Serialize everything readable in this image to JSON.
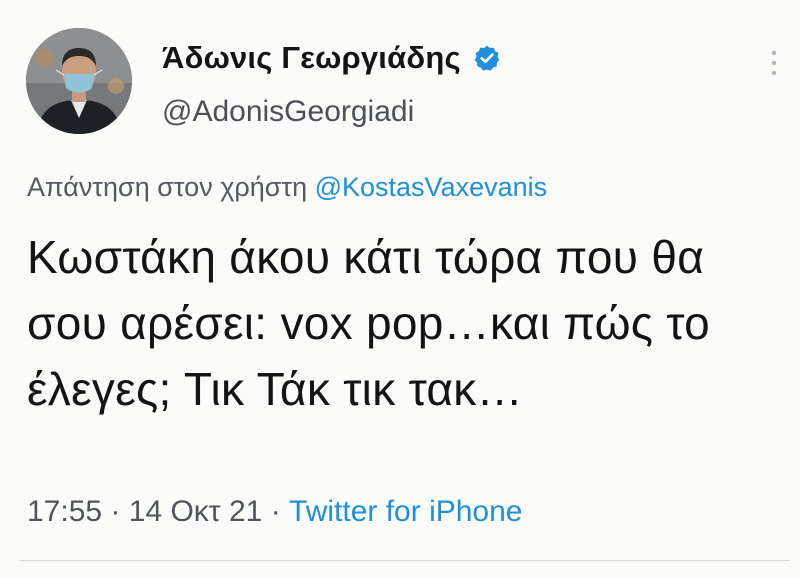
{
  "author": {
    "display_name": "Άδωνις Γεωργιάδης",
    "handle": "@AdonisGeorgiadi",
    "verified": true,
    "avatar_icon": "profile-photo"
  },
  "reply": {
    "prefix": "Απάντηση στον χρήστη",
    "mention": "@KostasVaxevanis"
  },
  "tweet": {
    "text": "Κωστάκη άκου κάτι τώρα που θα σου αρέσει: vox pop…και πώς το έλεγες; Τικ Τάκ τικ τακ…"
  },
  "meta": {
    "time": "17:55",
    "separator": "·",
    "date": "14 Οκτ 21",
    "source": "Twitter for iPhone"
  },
  "colors": {
    "accent": "#1f90db",
    "text": "#141414",
    "secondary": "#50555b",
    "background": "#fbfbf9"
  },
  "icons": {
    "verified": "verified-badge-icon",
    "more": "more-options-icon"
  }
}
